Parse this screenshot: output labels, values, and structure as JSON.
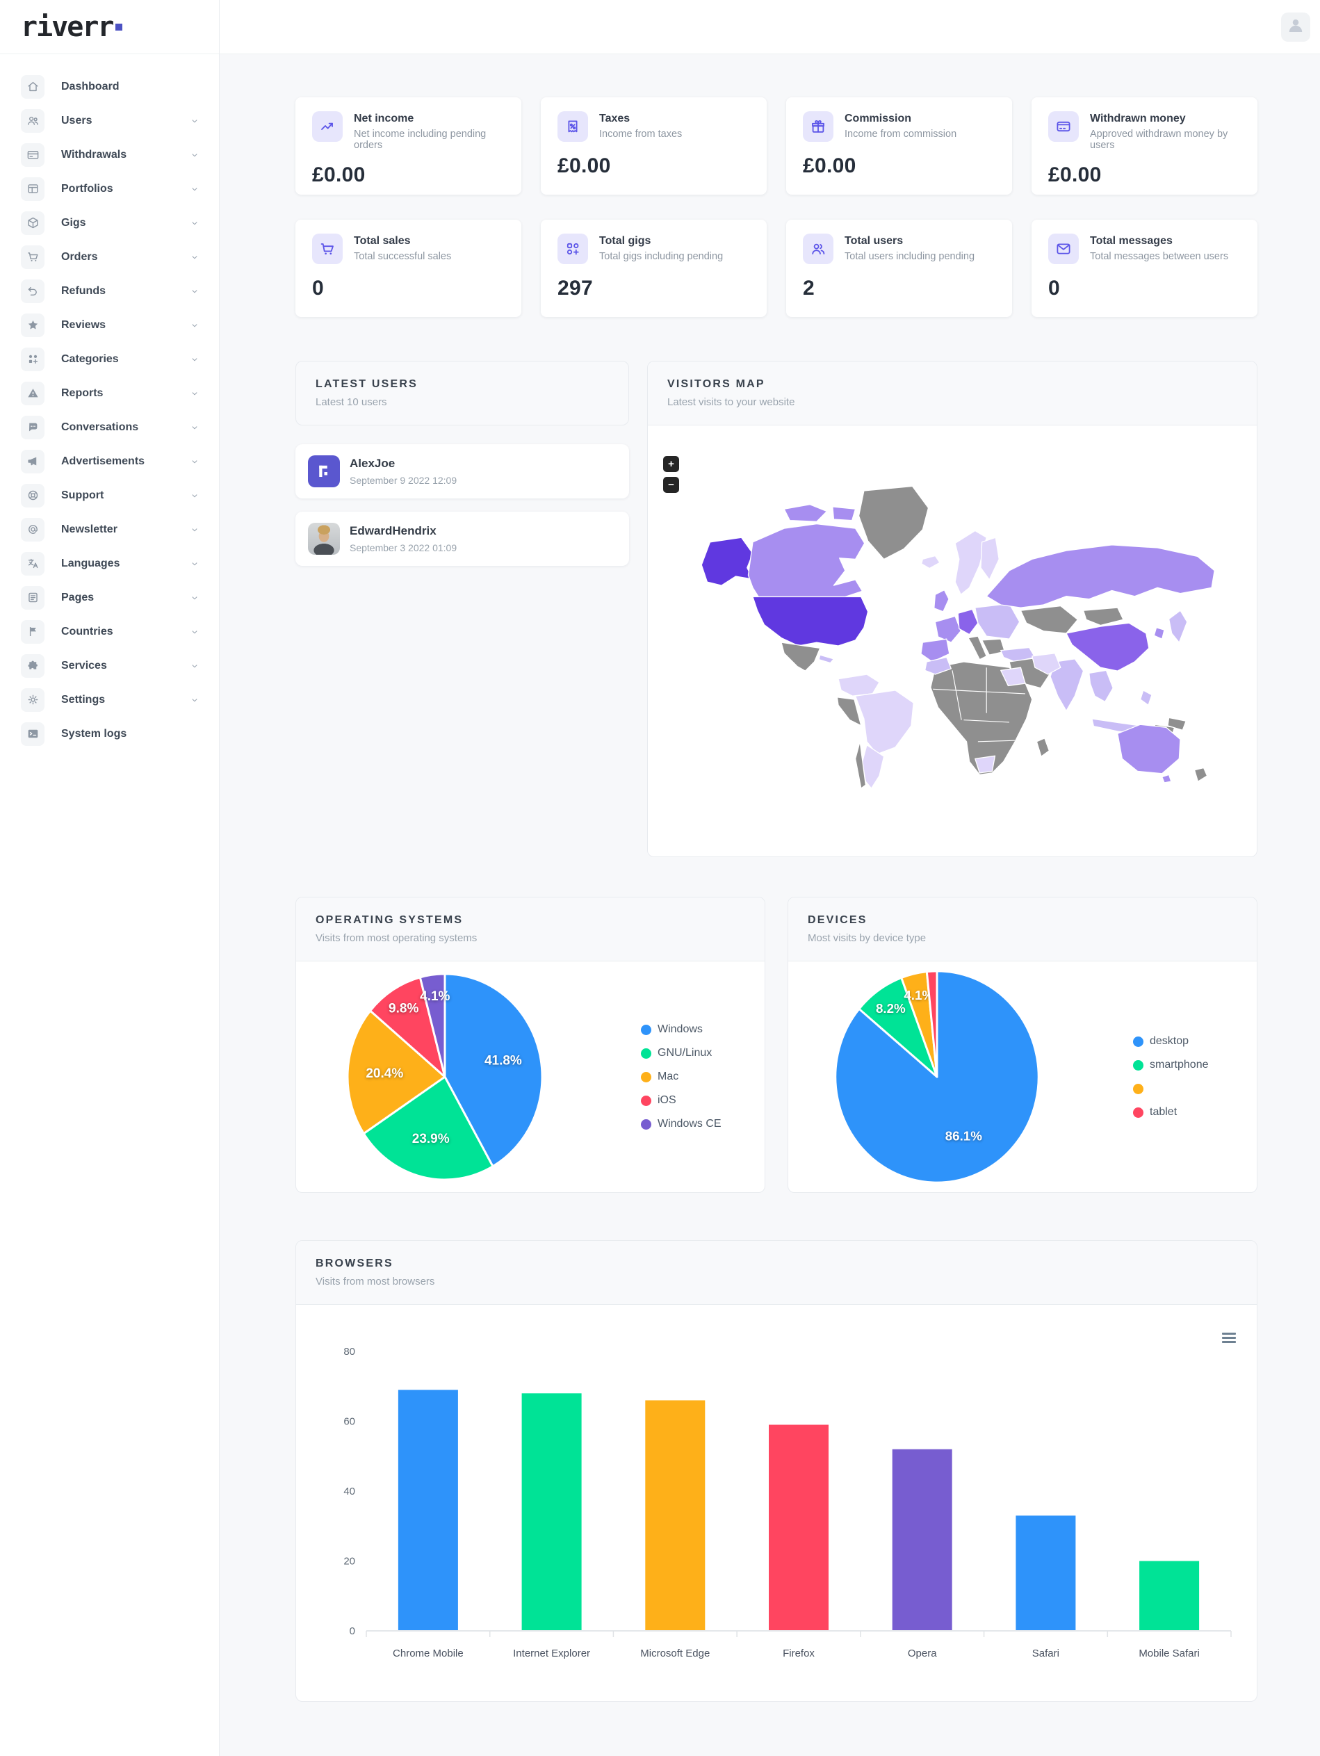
{
  "brand": {
    "name": "riverr"
  },
  "colors": {
    "accent": "#5B54E8",
    "palette": [
      "#2E93FA",
      "#00E396",
      "#FEB019",
      "#FF4560",
      "#775DD0"
    ],
    "map": {
      "highest": "#6038E0",
      "high": "#8A63EA",
      "medium": "#A78EF0",
      "low": "#C9BDF6",
      "lowest": "#DFD6FA",
      "empty": "#8F8F8F"
    }
  },
  "sidebar": {
    "items": [
      {
        "label": "Dashboard",
        "icon": "home",
        "expandable": false
      },
      {
        "label": "Users",
        "icon": "users",
        "expandable": true
      },
      {
        "label": "Withdrawals",
        "icon": "card",
        "expandable": true
      },
      {
        "label": "Portfolios",
        "icon": "columns",
        "expandable": true
      },
      {
        "label": "Gigs",
        "icon": "cube",
        "expandable": true
      },
      {
        "label": "Orders",
        "icon": "cart",
        "expandable": true
      },
      {
        "label": "Refunds",
        "icon": "refund",
        "expandable": true
      },
      {
        "label": "Reviews",
        "icon": "star",
        "expandable": true
      },
      {
        "label": "Categories",
        "icon": "categories",
        "expandable": true
      },
      {
        "label": "Reports",
        "icon": "warning",
        "expandable": true
      },
      {
        "label": "Conversations",
        "icon": "chat",
        "expandable": true
      },
      {
        "label": "Advertisements",
        "icon": "megaphone",
        "expandable": true
      },
      {
        "label": "Support",
        "icon": "lifering",
        "expandable": true
      },
      {
        "label": "Newsletter",
        "icon": "at",
        "expandable": true
      },
      {
        "label": "Languages",
        "icon": "translate",
        "expandable": true
      },
      {
        "label": "Pages",
        "icon": "doc",
        "expandable": true
      },
      {
        "label": "Countries",
        "icon": "flag",
        "expandable": true
      },
      {
        "label": "Services",
        "icon": "puzzle",
        "expandable": true
      },
      {
        "label": "Settings",
        "icon": "gear",
        "expandable": true
      },
      {
        "label": "System logs",
        "icon": "terminal",
        "expandable": false
      }
    ]
  },
  "stats": [
    {
      "title": "Net income",
      "subtitle": "Net income including pending orders",
      "value": "£0.00",
      "icon": "trend"
    },
    {
      "title": "Taxes",
      "subtitle": "Income from taxes",
      "value": "£0.00",
      "icon": "receipt"
    },
    {
      "title": "Commission",
      "subtitle": "Income from commission",
      "value": "£0.00",
      "icon": "gift"
    },
    {
      "title": "Withdrawn money",
      "subtitle": "Approved withdrawn money by users",
      "value": "£0.00",
      "icon": "creditcard"
    },
    {
      "title": "Total sales",
      "subtitle": "Total successful sales",
      "value": "0",
      "icon": "cart"
    },
    {
      "title": "Total gigs",
      "subtitle": "Total gigs including pending",
      "value": "297",
      "icon": "gridplus"
    },
    {
      "title": "Total users",
      "subtitle": "Total users including pending",
      "value": "2",
      "icon": "usersgroup"
    },
    {
      "title": "Total messages",
      "subtitle": "Total messages between users",
      "value": "0",
      "icon": "mail"
    }
  ],
  "latest_users": {
    "title": "LATEST USERS",
    "subtitle": "Latest 10 users",
    "users": [
      {
        "name": "AlexJoe",
        "date": "September 9 2022 12:09",
        "avatar": "brand"
      },
      {
        "name": "EdwardHendrix",
        "date": "September 3 2022 01:09",
        "avatar": "photo"
      }
    ]
  },
  "visitors_map": {
    "title": "VISITORS MAP",
    "subtitle": "Latest visits to your website",
    "zoom_in": "+",
    "zoom_out": "−",
    "countries_by_intensity": {
      "highest": [
        "United States"
      ],
      "high": [
        "China",
        "Germany"
      ],
      "medium": [
        "Canada",
        "Russia",
        "Australia",
        "United Kingdom",
        "France",
        "Spain"
      ],
      "low": [
        "India",
        "Japan",
        "Turkey",
        "Morocco",
        "Sweden",
        "Finland",
        "Indonesia",
        "Brazil",
        "Argentina",
        "Egypt",
        "Iran",
        "Colombia"
      ],
      "unshaded_gray": [
        "Greenland",
        "Mexico",
        "most of Africa",
        "Central Asia",
        "Mongolia",
        "New Zealand"
      ]
    }
  },
  "chart_data": [
    {
      "type": "pie",
      "title": "OPERATING SYSTEMS",
      "subtitle": "Visits from most operating systems",
      "labels": [
        "Windows",
        "GNU/Linux",
        "Mac",
        "iOS",
        "Windows CE"
      ],
      "values": [
        41.8,
        23.9,
        20.4,
        9.8,
        4.1
      ],
      "slice_labels": [
        "41.8%",
        "23.9%",
        "20.4%",
        "9.8%",
        "4.1%"
      ],
      "legend_position": "right"
    },
    {
      "type": "pie",
      "title": "DEVICES",
      "subtitle": "Most visits by device type",
      "labels": [
        "desktop",
        "smartphone",
        "",
        "tablet"
      ],
      "values": [
        86.1,
        8.2,
        4.1,
        1.6
      ],
      "slice_labels": [
        "86.1%",
        "8.2%",
        "4.1%",
        ""
      ],
      "legend_position": "right"
    },
    {
      "type": "bar",
      "title": "BROWSERS",
      "subtitle": "Visits from most browsers",
      "categories": [
        "Chrome Mobile",
        "Internet Explorer",
        "Microsoft Edge",
        "Firefox",
        "Opera",
        "Safari",
        "Mobile Safari"
      ],
      "values": [
        69,
        68,
        66,
        59,
        52,
        33,
        20
      ],
      "ylim": [
        0,
        80
      ],
      "yticks": [
        0,
        20,
        40,
        60,
        80
      ],
      "grid": false,
      "legend_position": "none"
    }
  ]
}
